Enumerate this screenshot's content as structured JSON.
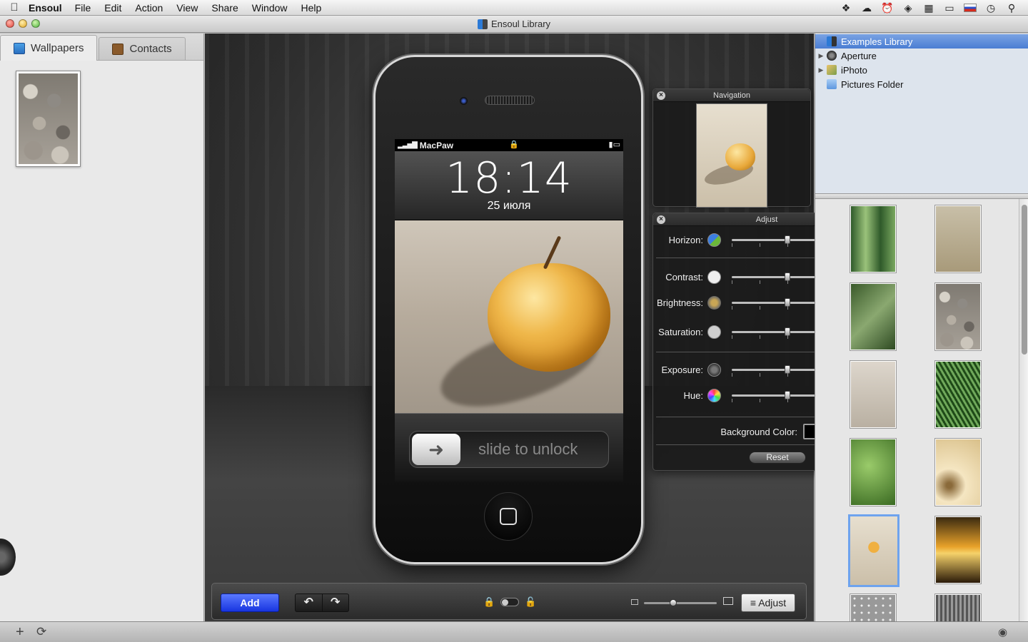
{
  "menubar": {
    "app_name": "Ensoul",
    "items": [
      "File",
      "Edit",
      "Action",
      "View",
      "Share",
      "Window",
      "Help"
    ],
    "status_icons": [
      "dropbox-icon",
      "cloud-icon",
      "alarm-icon",
      "wifi-icon",
      "memory-icon",
      "battery-icon",
      "flag-ru-icon",
      "clock-icon",
      "spotlight-icon"
    ]
  },
  "window": {
    "title": "Ensoul Library"
  },
  "left_panel": {
    "tabs": [
      {
        "label": "Wallpapers",
        "active": true
      },
      {
        "label": "Contacts",
        "active": false
      }
    ]
  },
  "phone": {
    "carrier": "MacPaw",
    "time": "18:14",
    "date": "25 июля",
    "slide_text": "slide to unlock"
  },
  "navigation_panel": {
    "title": "Navigation"
  },
  "adjust_panel": {
    "title": "Adjust",
    "sliders": [
      {
        "label": "Horizon:",
        "value": 0.5
      },
      {
        "label": "Contrast:",
        "value": 0.5
      },
      {
        "label": "Brightness:",
        "value": 0.5
      },
      {
        "label": "Saturation:",
        "value": 0.5
      },
      {
        "label": "Exposure:",
        "value": 0.5
      },
      {
        "label": "Hue:",
        "value": 0.5
      }
    ],
    "background_color_label": "Background Color:",
    "background_color": "#000000",
    "reset_label": "Reset"
  },
  "toolbar": {
    "add_label": "Add",
    "adjust_label": "Adjust",
    "zoom_value": 0.4
  },
  "source_list": {
    "items": [
      {
        "label": "Examples Library",
        "selected": true,
        "expandable": false
      },
      {
        "label": "Aperture",
        "selected": false,
        "expandable": true
      },
      {
        "label": "iPhoto",
        "selected": false,
        "expandable": true
      },
      {
        "label": "Pictures Folder",
        "selected": false,
        "expandable": false
      }
    ]
  },
  "colors": {
    "add_button": "#1f3df0",
    "selection": "#5a88d8",
    "apple": "#e8a83a"
  }
}
